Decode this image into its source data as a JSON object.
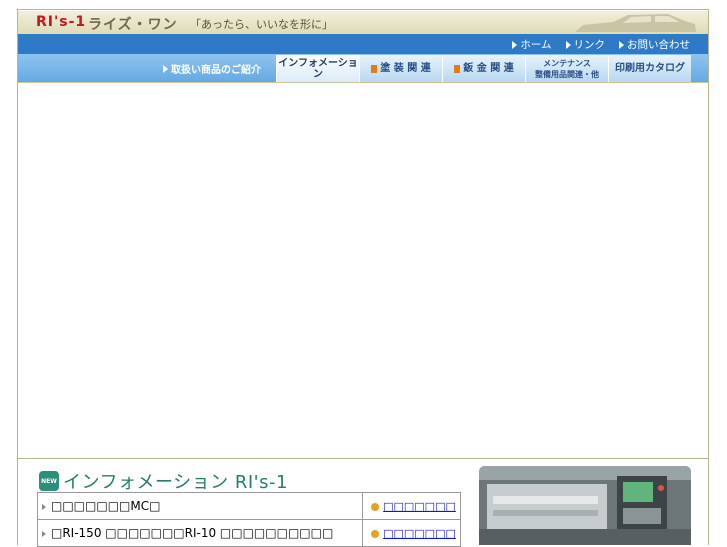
{
  "header": {
    "logo_brand": "RI's-1",
    "logo_kana": "ライズ・ワン",
    "tagline": "「あったら、いいなを形に」"
  },
  "topnav": {
    "items": [
      {
        "label": "ホーム"
      },
      {
        "label": "リンク"
      },
      {
        "label": "お問い合わせ"
      }
    ]
  },
  "mainnav": {
    "intro": "取扱い商品のご紹介",
    "tabs": [
      {
        "label": "インフォメーション"
      },
      {
        "label": "塗 装 関 連"
      },
      {
        "label": "鈑 金 関 連"
      },
      {
        "label": "メンテナンス",
        "sub": "整備用品関連・他"
      },
      {
        "label": "印刷用カタログ"
      }
    ]
  },
  "info": {
    "badge": "NEW",
    "title": "インフォメーション RI's-1",
    "rows": [
      {
        "title": "□□□□□□□MC□",
        "link": "□□□□□□□"
      },
      {
        "title": "□RI-150 □□□□□□□RI-10 □□□□□□□□□□",
        "link": "□□□□□□□"
      }
    ]
  },
  "colors": {
    "nav_blue": "#2e7ac6",
    "tab_blue": "#8ec4ee",
    "header_beige": "#e9e6c9",
    "brand_red": "#c8141e",
    "info_green": "#277c6c",
    "link_blue": "#1616c8"
  }
}
